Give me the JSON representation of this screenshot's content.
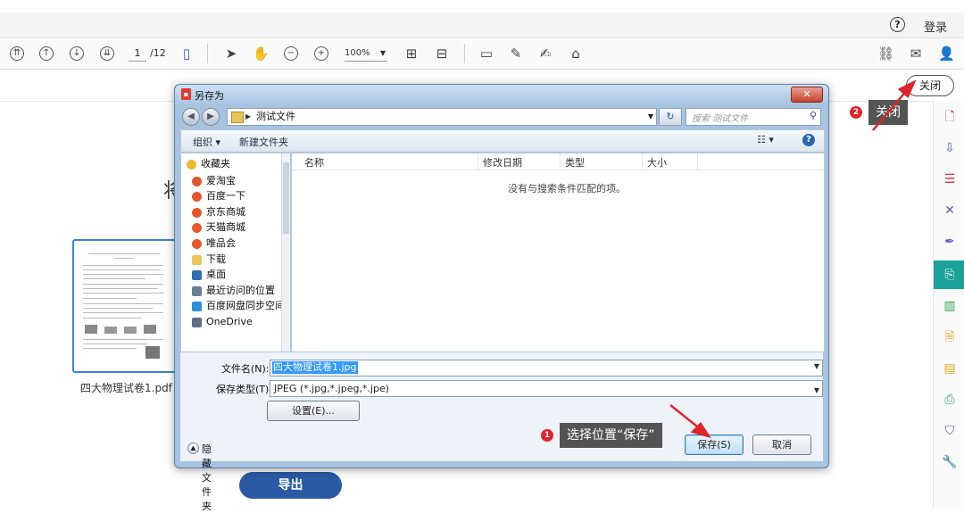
{
  "header": {
    "login": "登录"
  },
  "toolbar": {
    "page_current": "1",
    "page_total": "/12",
    "zoom": "100%"
  },
  "subbar": {
    "close_label": "关闭"
  },
  "document": {
    "partial_title": "将",
    "thumbnail_filename": "四大物理试卷1.pdf",
    "export_label": "导出"
  },
  "dialog": {
    "title": "另存为",
    "path": "测试文件",
    "search_placeholder": "搜索 测试文件",
    "organize_label": "组织 ▾",
    "new_folder_label": "新建文件夹",
    "nav": [
      {
        "label": "收藏夹",
        "icon": "star-icon",
        "color": "#f2b632"
      },
      {
        "label": "爱淘宝",
        "icon": "browser-icon",
        "color": "#e4572e"
      },
      {
        "label": "百度一下",
        "icon": "browser-icon",
        "color": "#e4572e"
      },
      {
        "label": "京东商城",
        "icon": "browser-icon",
        "color": "#e4572e"
      },
      {
        "label": "天猫商城",
        "icon": "browser-icon",
        "color": "#e4572e"
      },
      {
        "label": "唯品会",
        "icon": "browser-icon",
        "color": "#e4572e"
      },
      {
        "label": "下载",
        "icon": "download-folder-icon",
        "color": "#e8c45a"
      },
      {
        "label": "桌面",
        "icon": "desktop-icon",
        "color": "#2f6fb3"
      },
      {
        "label": "最近访问的位置",
        "icon": "recent-icon",
        "color": "#6a7f97"
      },
      {
        "label": "百度网盘同步空间",
        "icon": "cloud-sync-icon",
        "color": "#2a8fd9"
      },
      {
        "label": "OneDrive",
        "icon": "onedrive-icon",
        "color": "#5b6f86"
      }
    ],
    "columns": [
      "名称",
      "修改日期",
      "类型",
      "大小"
    ],
    "empty_message": "没有与搜索条件匹配的项。",
    "filename_label": "文件名(N):",
    "filename_value": "四大物理试卷1.jpg",
    "filetype_label": "保存类型(T):",
    "filetype_value": "JPEG (*.jpg,*.jpeg,*.jpe)",
    "settings_label": "设置(E)...",
    "hide_folders_label": "隐藏文件夹",
    "save_label": "保存(S)",
    "cancel_label": "取消"
  },
  "annotations": [
    {
      "number": "1",
      "text": "选择位置“保存”"
    },
    {
      "number": "2",
      "text": "关闭"
    }
  ],
  "colors": {
    "accent": "#2a5aa3",
    "sidebar_active": "#1aa39a",
    "annotation_badge": "#e0242a",
    "annotation_arrow": "#e0242a"
  }
}
